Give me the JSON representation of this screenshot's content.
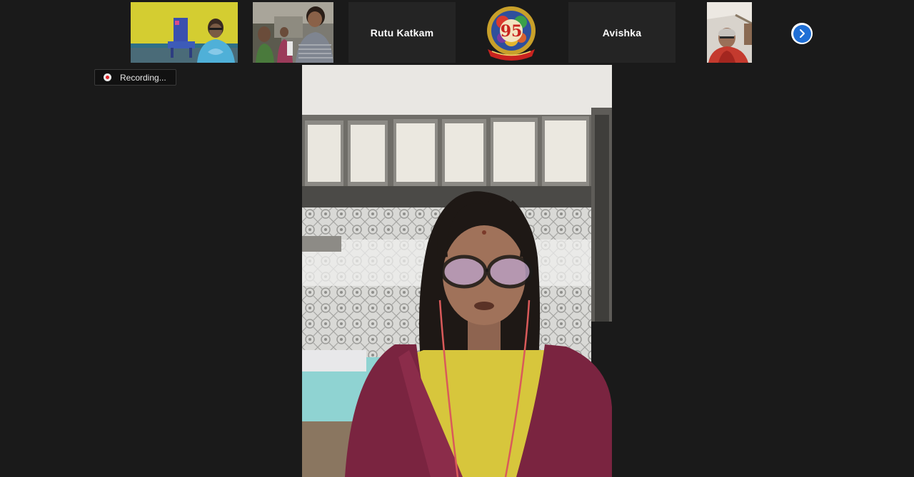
{
  "window": {
    "background": "#1a1a1a"
  },
  "participant_strip": {
    "tiles": [
      {
        "type": "video",
        "label": ""
      },
      {
        "type": "video",
        "label": ""
      },
      {
        "type": "name",
        "label": "Rutu Katkam"
      },
      {
        "type": "avatar-logo",
        "label": ""
      },
      {
        "type": "name",
        "label": "Avishka"
      },
      {
        "type": "video",
        "label": ""
      }
    ],
    "next_page_icon": "chevron-right-icon",
    "accent": "#1f6fd6"
  },
  "recording": {
    "label": "Recording...",
    "icon": "record-icon",
    "indicator_color": "#e0242a"
  },
  "active_speaker": {
    "type": "video"
  }
}
